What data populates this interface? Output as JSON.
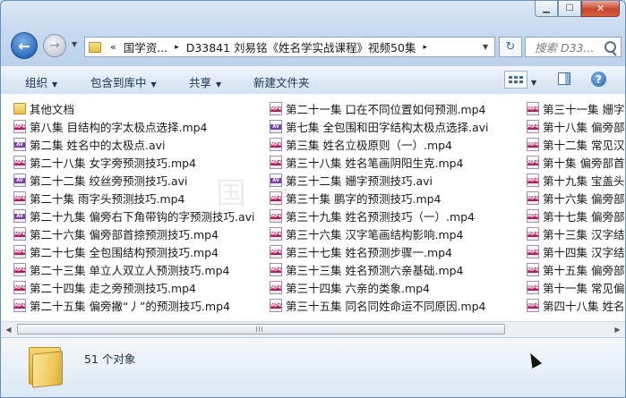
{
  "window": {
    "minimize_glyph": "▁",
    "maximize_glyph": "☐",
    "close_glyph": "✕"
  },
  "nav": {
    "back_glyph": "←",
    "forward_glyph": "→",
    "breadcrumb_sep": "«",
    "crumbs": [
      "国学资...",
      "D33841 刘易铭《姓名学实战课程》视频50集"
    ],
    "crumb_arrow": "▸",
    "search_placeholder": "搜索 D33...",
    "refresh_glyph": "↻"
  },
  "toolbar": {
    "organize": "组织",
    "include_in_library": "包含到库中",
    "share": "共享",
    "new_folder": "新建文件夹",
    "help": "?"
  },
  "files": {
    "column1": [
      {
        "name": "其他文档",
        "type": "folder"
      },
      {
        "name": "第八集 目结构的字太极点选择.mp4",
        "type": "mp4"
      },
      {
        "name": "第二集 姓名中的太极点.avi",
        "type": "avi"
      },
      {
        "name": "第二十八集 女字旁预测技巧.mp4",
        "type": "mp4"
      },
      {
        "name": "第二十二集 绞丝旁预测技巧.avi",
        "type": "avi"
      },
      {
        "name": "第二十集 雨字头预测技巧.mp4",
        "type": "mp4"
      },
      {
        "name": "第二十九集 偏旁右下角带钩的字预测技巧.avi",
        "type": "avi"
      },
      {
        "name": "第二十六集 偏旁部首捺预测技巧.mp4",
        "type": "mp4"
      },
      {
        "name": "第二十七集 全包围结构预测技巧.mp4",
        "type": "mp4"
      },
      {
        "name": "第二十三集 单立人双立人预测技巧.mp4",
        "type": "mp4"
      },
      {
        "name": "第二十四集 走之旁预测技巧.mp4",
        "type": "mp4"
      },
      {
        "name": "第二十五集 偏旁撇“丿”的预测技巧.mp4",
        "type": "mp4"
      }
    ],
    "column2": [
      {
        "name": "第二十一集 口在不同位置如何预测.mp4",
        "type": "mp4"
      },
      {
        "name": "第七集 全包围和田字结构太极点选择.avi",
        "type": "avi"
      },
      {
        "name": "第三集 姓名立极原则（一）.mp4",
        "type": "mp4"
      },
      {
        "name": "第三十八集 姓名笔画阴阳生克.mp4",
        "type": "mp4"
      },
      {
        "name": "第三十二集 姗字预测技巧.avi",
        "type": "avi"
      },
      {
        "name": "第三十集 鹏字的预测技巧.mp4",
        "type": "mp4"
      },
      {
        "name": "第三十九集 姓名预测技巧（一）.mp4",
        "type": "mp4"
      },
      {
        "name": "第三十六集 汉字笔画结构影响.mp4",
        "type": "mp4"
      },
      {
        "name": "第三十七集 姓名预测步骤一.mp4",
        "type": "mp4"
      },
      {
        "name": "第三十三集 姓名预测六亲基础.mp4",
        "type": "mp4"
      },
      {
        "name": "第三十四集 六亲的类象.mp4",
        "type": "mp4"
      },
      {
        "name": "第三十五集 同名同姓命运不同原因.mp4",
        "type": "mp4"
      }
    ],
    "column3": [
      {
        "name": "第三十一集 姗字",
        "type": "mp4"
      },
      {
        "name": "第十八集 偏旁部",
        "type": "mp4"
      },
      {
        "name": "第十二集 常见汉",
        "type": "mp4"
      },
      {
        "name": "第十集 偏旁部首",
        "type": "mp4"
      },
      {
        "name": "第十九集 宝盖头",
        "type": "mp4"
      },
      {
        "name": "第十六集 偏旁部",
        "type": "mp4"
      },
      {
        "name": "第十七集 偏旁部",
        "type": "mp4"
      },
      {
        "name": "第十三集 汉字结",
        "type": "mp4"
      },
      {
        "name": "第十四集 汉字结",
        "type": "mp4"
      },
      {
        "name": "第十五集 偏旁部",
        "type": "mp4"
      },
      {
        "name": "第十一集 常见偏",
        "type": "mp4"
      },
      {
        "name": "第四十八集 姓名",
        "type": "mp4"
      }
    ]
  },
  "watermark": "国学",
  "status": {
    "count": "51 个对象"
  }
}
